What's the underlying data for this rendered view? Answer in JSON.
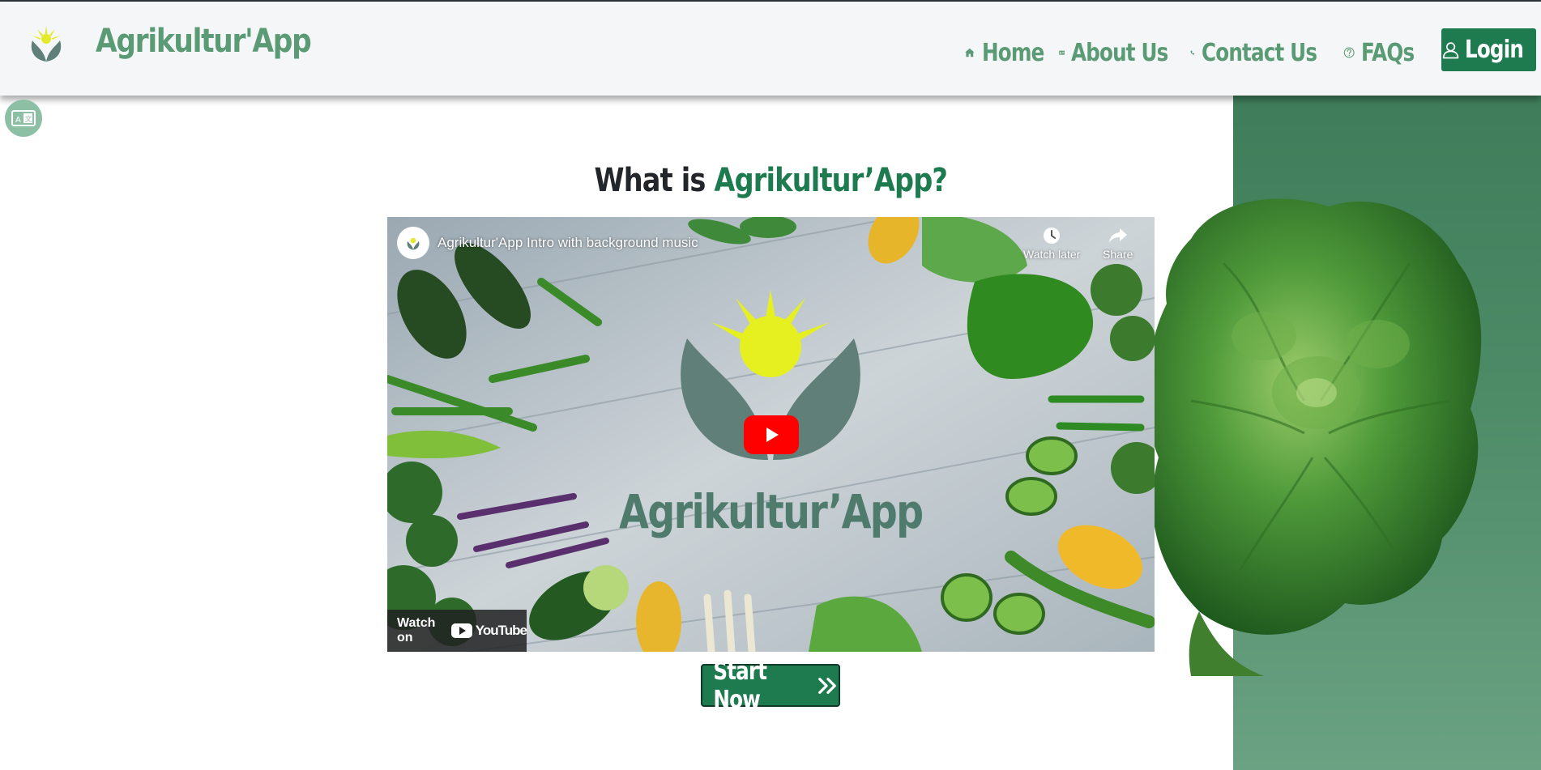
{
  "brand": {
    "name": "Agrikultur'App"
  },
  "nav": {
    "items": [
      {
        "label": "Home",
        "icon": "home-icon"
      },
      {
        "label": "About Us",
        "icon": "id-card-icon"
      },
      {
        "label": "Contact Us",
        "icon": "phone-icon"
      },
      {
        "label": "FAQs",
        "icon": "question-circle-icon"
      }
    ],
    "login": {
      "label": "Login",
      "icon": "user-icon"
    }
  },
  "hero": {
    "headline_prefix": "What is ",
    "headline_highlight": "Agrikultur’App?",
    "start_label": "Start Now"
  },
  "video": {
    "title": "Agrikultur'App Intro with background music",
    "watch_later": "Watch later",
    "share": "Share",
    "watch_on": "Watch on",
    "youtube": "YouTube",
    "brand_overlay": "Agrikultur’App"
  },
  "colors": {
    "brand_green": "#1e7a4f",
    "muted_green": "#5a9a74",
    "youtube_red": "#ff0000"
  }
}
